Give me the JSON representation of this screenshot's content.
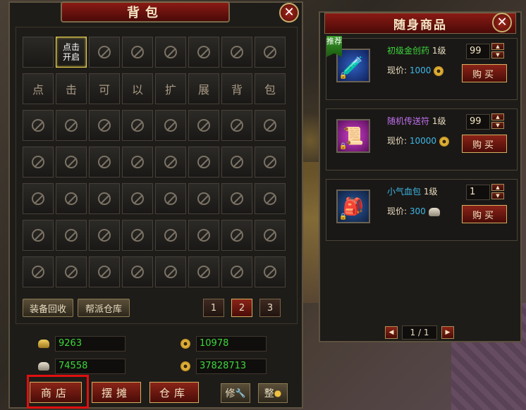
{
  "bag": {
    "title": "背包",
    "close_label": "✕",
    "open_slot_label": "点击\n开启",
    "expand_chars": [
      "点",
      "击",
      "可",
      "以",
      "扩",
      "展",
      "背",
      "包"
    ],
    "btn_recycle": "装备回收",
    "btn_guild_storage": "帮派仓库",
    "pages": [
      "1",
      "2",
      "3"
    ],
    "active_page": "2",
    "currency": {
      "gold_ingot": "9263",
      "silver_ingot": "74558",
      "coin": "10978",
      "bound_coin": "37828713"
    },
    "btn_shop": "商店",
    "btn_stall": "摆摊",
    "btn_warehouse": "仓库",
    "btn_repair": "修",
    "btn_sort": "整"
  },
  "shop": {
    "title": "随身商品",
    "close_label": "✕",
    "items": [
      {
        "name": "初级金创药",
        "level": "1级",
        "price_label": "现价:",
        "price": "1000",
        "qty": "99",
        "buy": "购买",
        "tag": "推荐",
        "name_color": "#3cd83c",
        "icon": "potion-icon",
        "currency_icon": "coin"
      },
      {
        "name": "随机传送符",
        "level": "1级",
        "price_label": "现价:",
        "price": "10000",
        "qty": "99",
        "buy": "购买",
        "tag": "",
        "name_color": "#c070f0",
        "icon": "scroll-icon",
        "currency_icon": "coin"
      },
      {
        "name": "小气血包",
        "level": "1级",
        "price_label": "现价:",
        "price": "300",
        "qty": "1",
        "buy": "购买",
        "tag": "",
        "name_color": "#3cb8e8",
        "icon": "bag-icon",
        "currency_icon": "silver-ingot"
      }
    ],
    "page_indicator": "1 / 1"
  }
}
